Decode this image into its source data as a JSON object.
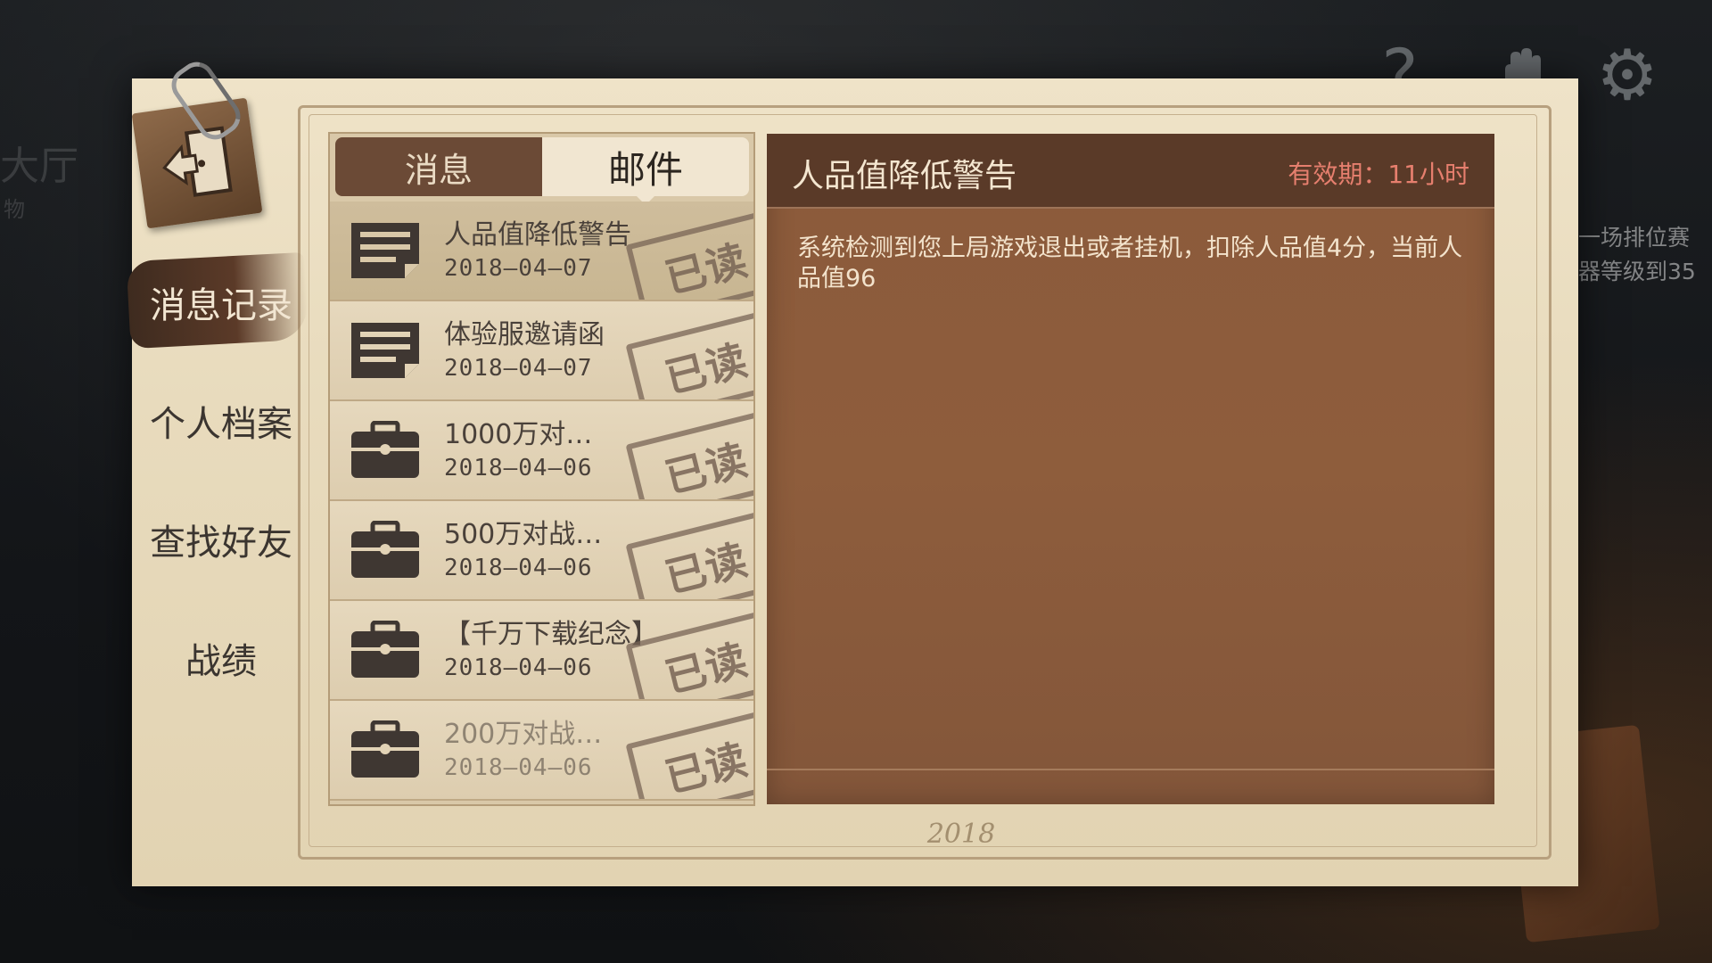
{
  "background": {
    "left_text": "大厅",
    "left_sub": "物",
    "right_lines": [
      "一场排位赛",
      "器等级到35"
    ]
  },
  "top_icons": [
    "help-icon",
    "hand-icon",
    "gear-icon"
  ],
  "nav": {
    "items": [
      {
        "label": "消息记录",
        "active": true
      },
      {
        "label": "个人档案",
        "active": false
      },
      {
        "label": "查找好友",
        "active": false
      },
      {
        "label": "战绩",
        "active": false
      }
    ]
  },
  "tabs": [
    {
      "label": "消息",
      "active": false
    },
    {
      "label": "邮件",
      "active": true
    }
  ],
  "mails": [
    {
      "icon": "letter-icon",
      "title": "人品值降低警告",
      "date": "2018—04—07",
      "stamp": "已读",
      "selected": true
    },
    {
      "icon": "letter-icon",
      "title": "体验服邀请函",
      "date": "2018—04—07",
      "stamp": "已读",
      "selected": false
    },
    {
      "icon": "briefcase-icon",
      "title": "1000万对…",
      "date": "2018—04—06",
      "stamp": "已读",
      "selected": false
    },
    {
      "icon": "briefcase-icon",
      "title": "500万对战…",
      "date": "2018—04—06",
      "stamp": "已读",
      "selected": false
    },
    {
      "icon": "briefcase-icon",
      "title": "【千万下载纪念】",
      "date": "2018—04—06",
      "stamp": "已读",
      "selected": false
    },
    {
      "icon": "briefcase-icon",
      "title": "200万对战…",
      "date": "2018—04—06",
      "stamp": "已读",
      "selected": false
    }
  ],
  "detail": {
    "title": "人品值降低警告",
    "expiry": "有效期：11小时",
    "body": "系统检测到您上局游戏退出或者挂机，扣除人品值4分，当前人品值96"
  },
  "footer_mark": "2018",
  "colors": {
    "paper": "#e8dbbd",
    "detail_bg": "#8b5a3b",
    "detail_header": "#5a3a28",
    "expiry": "#e67f6e",
    "tab_inactive": "#6b4a36"
  }
}
